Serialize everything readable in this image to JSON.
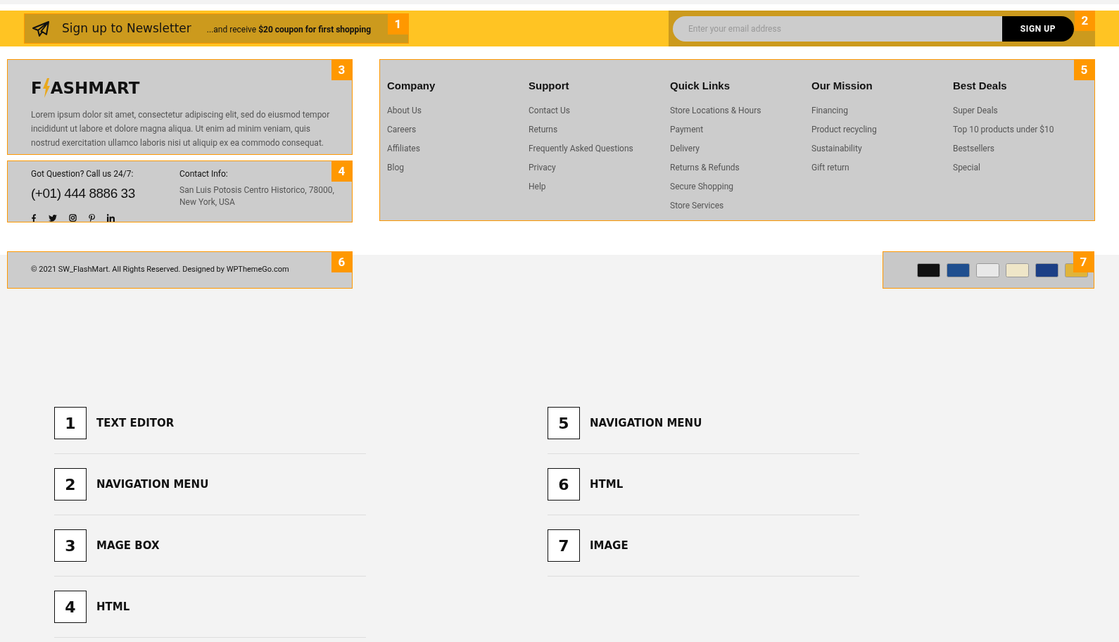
{
  "newsletter": {
    "badge": "1",
    "title": "Sign up to Newsletter",
    "subtitle": "...and receive **$20 coupon for first shopping**"
  },
  "signup": {
    "badge": "2",
    "placeholder": "Enter your email address",
    "button": "SIGN UP"
  },
  "about": {
    "badge": "3",
    "logo_left": "F",
    "logo_right": "ASHMART",
    "text": "Lorem ipsum dolor sit amet, consectetur adipiscing elit, sed do eiusmod tempor incididunt ut labore et dolore magna aliqua. Ut enim ad minim veniam, quis nostrud exercitation ullamco laboris nisi ut aliquip ex ea commodo consequat."
  },
  "contact": {
    "badge": "4",
    "question": "Got Question? Call us 24/7:",
    "phone": "(+01) 444 8886 33",
    "info_label": "Contact Info:",
    "address": "San Luis Potosis Centro Historico, 78000, New York, USA"
  },
  "menus": {
    "badge": "5",
    "columns": [
      {
        "title": "Company",
        "links": [
          "About Us",
          "Careers",
          "Affiliates",
          "Blog"
        ]
      },
      {
        "title": "Support",
        "links": [
          "Contact Us",
          "Returns",
          "Frequently Asked Questions",
          "Privacy",
          "Help"
        ]
      },
      {
        "title": "Quick Links",
        "links": [
          "Store Locations & Hours",
          "Payment",
          "Delivery",
          "Returns & Refunds",
          "Secure Shopping",
          "Store Services"
        ]
      },
      {
        "title": "Our Mission",
        "links": [
          "Financing",
          "Product recycling",
          "Sustainability",
          "Gift return"
        ]
      },
      {
        "title": "Best Deals",
        "links": [
          "Super Deals",
          "Top 10 products under $10",
          "Bestsellers",
          "Special"
        ]
      }
    ]
  },
  "copyright": {
    "badge": "6",
    "text": "© 2021 SW_FlashMart. All Rights Reserved. Designed by WPThemeGo.com"
  },
  "payments": {
    "badge": "7",
    "cards": [
      {
        "color": "#111111"
      },
      {
        "color": "#1f4f8f"
      },
      {
        "color": "#e8e8e8"
      },
      {
        "color": "#efe6c8"
      },
      {
        "color": "#1c3f86"
      },
      {
        "color": "#e0b43a"
      }
    ]
  },
  "legend": [
    {
      "number": "1",
      "label": "TEXT EDITOR"
    },
    {
      "number": "2",
      "label": "NAVIGATION MENU"
    },
    {
      "number": "3",
      "label": "MAGE BOX"
    },
    {
      "number": "4",
      "label": "HTML"
    },
    {
      "number": "5",
      "label": "NAVIGATION MENU"
    },
    {
      "number": "6",
      "label": "HTML"
    },
    {
      "number": "7",
      "label": "IMAGE"
    }
  ]
}
